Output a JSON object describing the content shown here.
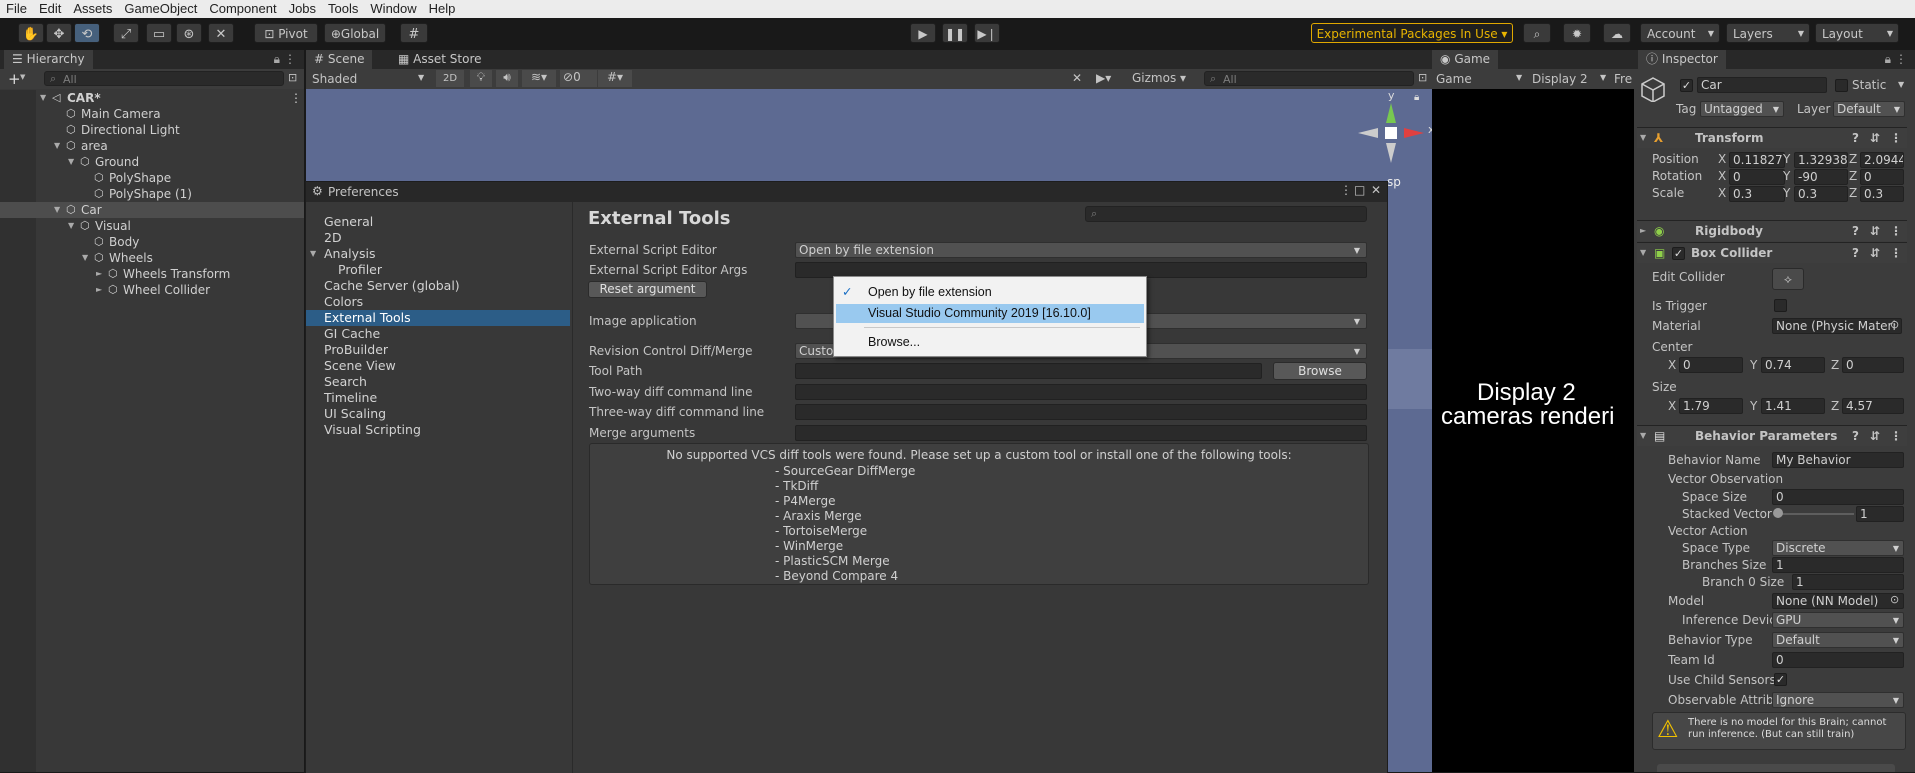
{
  "menu": [
    "File",
    "Edit",
    "Assets",
    "GameObject",
    "Component",
    "Jobs",
    "Tools",
    "Window",
    "Help"
  ],
  "toolbar": {
    "pivot": "Pivot",
    "global": "Global",
    "experimental": "Experimental Packages In Use ▾",
    "account": "Account",
    "layers": "Layers",
    "layout": "Layout"
  },
  "hierarchy": {
    "tab": "Hierarchy",
    "search_placeholder": "All",
    "rows": [
      {
        "label": "CAR*",
        "indent": 0,
        "arrow": "▼",
        "bold": true,
        "scene": true
      },
      {
        "label": "Main Camera",
        "indent": 1,
        "arrow": ""
      },
      {
        "label": "Directional Light",
        "indent": 1,
        "arrow": ""
      },
      {
        "label": "area",
        "indent": 1,
        "arrow": "▼"
      },
      {
        "label": "Ground",
        "indent": 2,
        "arrow": "▼"
      },
      {
        "label": "PolyShape",
        "indent": 3,
        "arrow": ""
      },
      {
        "label": "PolyShape (1)",
        "indent": 3,
        "arrow": ""
      },
      {
        "label": "Car",
        "indent": 1,
        "arrow": "▼",
        "selected": true
      },
      {
        "label": "Visual",
        "indent": 2,
        "arrow": "▼"
      },
      {
        "label": "Body",
        "indent": 3,
        "arrow": ""
      },
      {
        "label": "Wheels",
        "indent": 3,
        "arrow": "▼"
      },
      {
        "label": "Wheels Transform",
        "indent": 4,
        "arrow": "►"
      },
      {
        "label": "Wheel Collider",
        "indent": 4,
        "arrow": "►"
      }
    ]
  },
  "scene": {
    "tab": "Scene",
    "asset_tab": "Asset Store",
    "shading": "Shaded",
    "mode2d": "2D",
    "hidden_count": "0",
    "gizmos": "Gizmos",
    "search_placeholder": "All",
    "axis_x": "x",
    "axis_y": "y",
    "persp_fragment": "sp"
  },
  "game": {
    "tab": "Game",
    "mode": "Game",
    "display": "Display 2",
    "free": "Fre",
    "msg1": "Display 2",
    "msg2": "cameras renderi"
  },
  "inspector": {
    "tab": "Inspector",
    "object_name": "Car",
    "static": "Static",
    "tag_label": "Tag",
    "tag_value": "Untagged",
    "layer_label": "Layer",
    "layer_value": "Default",
    "transform": {
      "title": "Transform",
      "rows": [
        {
          "label": "Position",
          "x": "0.11827",
          "y": "1.32938",
          "z": "2.0944"
        },
        {
          "label": "Rotation",
          "x": "0",
          "y": "-90",
          "z": "0"
        },
        {
          "label": "Scale",
          "x": "0.3",
          "y": "0.3",
          "z": "0.3"
        }
      ]
    },
    "rigidbody": "Rigidbody",
    "box_collider": {
      "title": "Box Collider",
      "edit_collider": "Edit Collider",
      "is_trigger": "Is Trigger",
      "material_label": "Material",
      "material_value": "None (Physic Materi",
      "center_label": "Center",
      "center": {
        "x": "0",
        "y": "0.74",
        "z": "0"
      },
      "size_label": "Size",
      "size": {
        "x": "1.79",
        "y": "1.41",
        "z": "4.57"
      }
    },
    "behavior": {
      "title": "Behavior Parameters",
      "behavior_name_label": "Behavior Name",
      "behavior_name": "My Behavior",
      "vector_observation": "Vector Observation",
      "space_size_label": "Space Size",
      "space_size": "0",
      "stacked_label": "Stacked Vector",
      "stacked_value": "1",
      "vector_action": "Vector Action",
      "space_type_label": "Space Type",
      "space_type": "Discrete",
      "branches_label": "Branches Size",
      "branches": "1",
      "branch0_label": "Branch 0 Size",
      "branch0": "1",
      "model_label": "Model",
      "model": "None (NN Model)",
      "inference_label": "Inference Devic",
      "inference": "GPU",
      "behavior_type_label": "Behavior Type",
      "behavior_type": "Default",
      "team_label": "Team Id",
      "team": "0",
      "child_label": "Use Child Sensors",
      "observable_label": "Observable Attribu",
      "observable": "Ignore",
      "warning": "There is no model for this Brain; cannot run inference. (But can still train)"
    }
  },
  "preferences": {
    "title": "Preferences",
    "categories": [
      "General",
      "2D",
      "Analysis",
      "Profiler",
      "Cache Server (global)",
      "Colors",
      "External Tools",
      "GI Cache",
      "ProBuilder",
      "Scene View",
      "Search",
      "Timeline",
      "UI Scaling",
      "Visual Scripting"
    ],
    "heading": "External Tools",
    "ext_editor_label": "External Script Editor",
    "ext_editor_value": "Open by file extension",
    "ext_args_label": "External Script Editor Args",
    "reset_button": "Reset argument",
    "image_app_label": "Image application",
    "revision_label": "Revision Control Diff/Merge",
    "revision_value": "Custom Tool",
    "tool_path_label": "Tool Path",
    "browse_button": "Browse",
    "two_way_label": "Two-way diff command line",
    "three_way_label": "Three-way diff command line",
    "merge_args_label": "Merge arguments",
    "vcs_message": "No supported VCS diff tools were found. Please set up a custom tool or install one of the following tools:",
    "vcs_tools": [
      "- SourceGear DiffMerge",
      "- TkDiff",
      "- P4Merge",
      "- Araxis Merge",
      "- TortoiseMerge",
      "- WinMerge",
      "- PlasticSCM Merge",
      "- Beyond Compare 4"
    ],
    "dropdown": {
      "options": [
        "Open by file extension",
        "Visual Studio Community 2019 [16.10.0]",
        "Browse..."
      ]
    }
  },
  "colors": {
    "selection": "#2c5d87",
    "dropdown_highlight": "#99c9ef",
    "scene_sky": "#5d6a92",
    "warning_yellow": "#e0a800"
  }
}
